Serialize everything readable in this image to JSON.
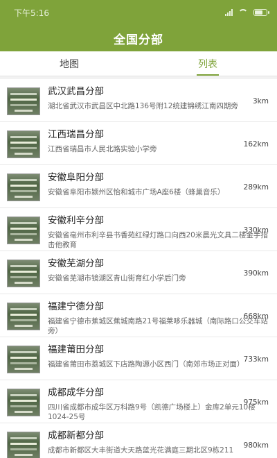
{
  "status_bar": {
    "time": "下午5:16"
  },
  "header": {
    "title": "全国分部"
  },
  "tabs": [
    {
      "label": "地图",
      "active": false
    },
    {
      "label": "列表",
      "active": true
    }
  ],
  "branches": [
    {
      "name": "武汉武昌分部",
      "address": "湖北省武汉市武昌区中北路136号附12统建锦绣江南四期旁",
      "distance": "3km"
    },
    {
      "name": "江西瑞昌分部",
      "address": "江西省瑞昌市人民北路实验小学旁",
      "distance": "162km"
    },
    {
      "name": "安徽阜阳分部",
      "address": "安徽省阜阳市颍州区怡和城市广场A座6楼（蜂巢音乐）",
      "distance": "289km"
    },
    {
      "name": "安徽利辛分部",
      "address": "安徽省亳州市利辛县书香苑红绿灯路口向西20米晨光文具二楼金手指击他教育",
      "distance": "330km"
    },
    {
      "name": "安徽芜湖分部",
      "address": "安徽省芜湖市镜湖区青山街育红小学后门旁",
      "distance": "390km"
    },
    {
      "name": "福建宁德分部",
      "address": "福建省宁德市蕉城区蕉城南路21号福莱哆乐器城（南际路口公交车站旁）",
      "distance": "668km"
    },
    {
      "name": "福建莆田分部",
      "address": "福建省莆田市荔城区下店路陶源小区西门（南郊市场正对面）",
      "distance": "733km"
    },
    {
      "name": "成都成华分部",
      "address": "四川省成都市成华区万科路9号（凯德广场楼上）金库2单元10楼1024-25号",
      "distance": "975km"
    },
    {
      "name": "成都新都分部",
      "address": "成都市新都区大丰街道大天路蓝光花满庭三期北区9栋211",
      "distance": "980km"
    }
  ]
}
